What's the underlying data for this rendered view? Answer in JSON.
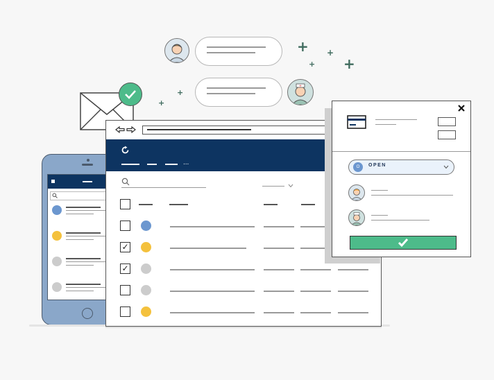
{
  "colors": {
    "navy": "#0d3461",
    "green": "#4dbb8a",
    "blue_dot": "#6c97cf",
    "yellow_dot": "#f4c13d",
    "gray_dot": "#cccccc",
    "plus": "#3f6b5e"
  },
  "icons": {
    "close": "close-icon",
    "check": "check-icon",
    "refresh": "refresh-icon",
    "search": "search-icon",
    "back": "arrow-left-icon",
    "forward": "arrow-right-icon",
    "menu": "menu-icon",
    "envelope": "envelope-icon",
    "card": "credit-card-icon",
    "chevron": "chevron-down-icon"
  },
  "popup": {
    "status": {
      "label": "OPEN",
      "badge": "O"
    }
  },
  "browser": {
    "header_ellipsis": "..."
  },
  "table": {
    "rows": [
      {
        "checked": false,
        "dot": "blue"
      },
      {
        "checked": true,
        "dot": "yellow"
      },
      {
        "checked": true,
        "dot": "gray"
      },
      {
        "checked": false,
        "dot": "gray"
      },
      {
        "checked": false,
        "dot": "yellow"
      }
    ]
  },
  "phone_list": [
    {
      "dot": "blue"
    },
    {
      "dot": "yellow"
    },
    {
      "dot": "gray"
    },
    {
      "dot": "gray"
    }
  ]
}
